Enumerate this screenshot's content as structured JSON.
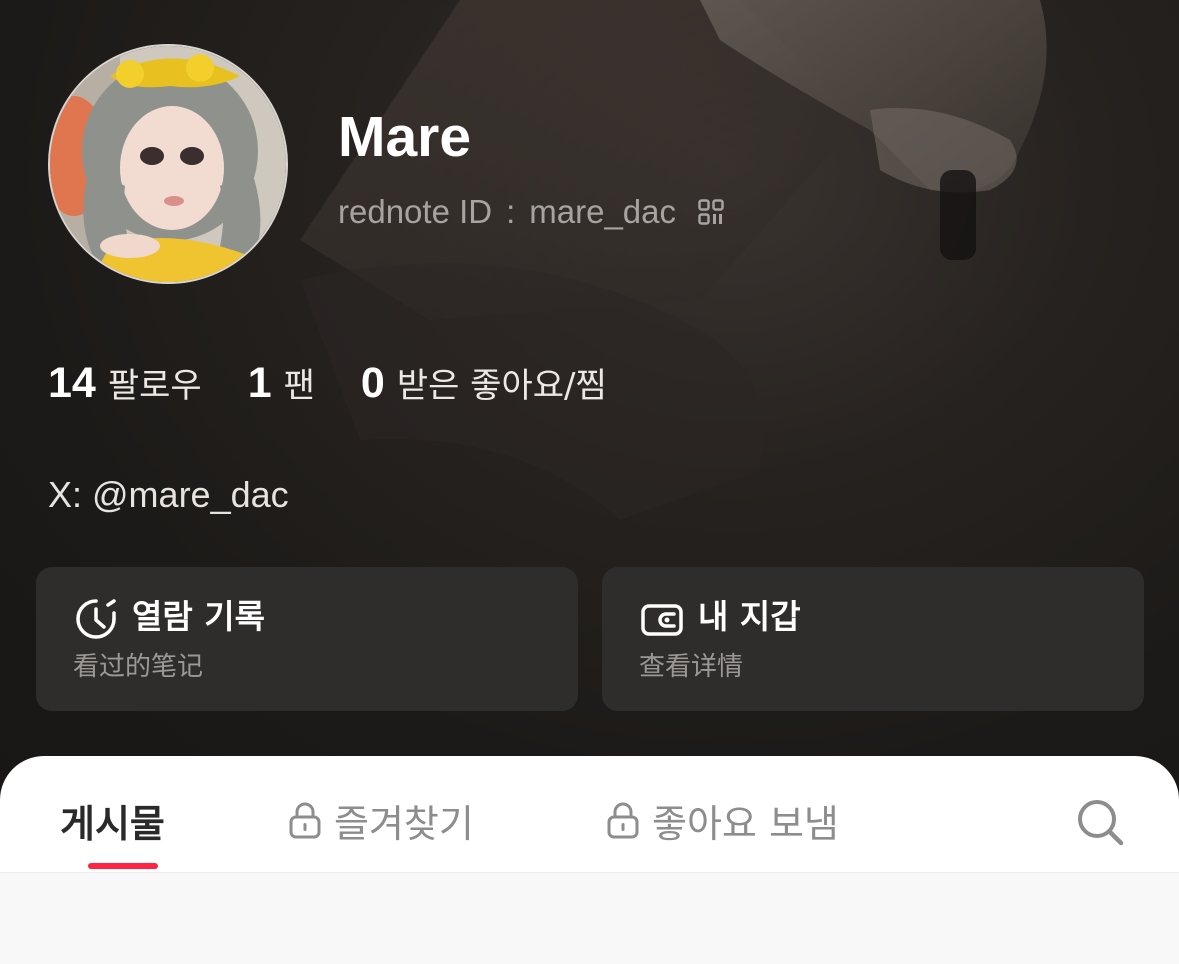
{
  "profile": {
    "name": "Mare",
    "id_label": "rednote ID",
    "id_separator": ":",
    "id_value": "mare_dac",
    "bio": "X: @mare_dac"
  },
  "stats": [
    {
      "value": "14",
      "label": "팔로우"
    },
    {
      "value": "1",
      "label": "팬"
    },
    {
      "value": "0",
      "label": "받은 좋아요/찜"
    }
  ],
  "cards": {
    "history": {
      "title": "열람 기록",
      "subtitle": "看过的笔记",
      "icon": "history-clock-icon"
    },
    "wallet": {
      "title": "내 지갑",
      "subtitle": "查看详情",
      "icon": "wallet-icon"
    }
  },
  "tabs": [
    {
      "label": "게시물",
      "active": true,
      "locked": false
    },
    {
      "label": "즐겨찾기",
      "active": false,
      "locked": true
    },
    {
      "label": "좋아요 보냄",
      "active": false,
      "locked": true
    }
  ],
  "colors": {
    "accent": "#ff2442",
    "background": "#1b1918",
    "card": "#2f2d2c",
    "sheet": "#ffffff"
  },
  "icons": [
    "qr-code-icon",
    "history-clock-icon",
    "wallet-icon",
    "lock-icon",
    "search-icon"
  ]
}
